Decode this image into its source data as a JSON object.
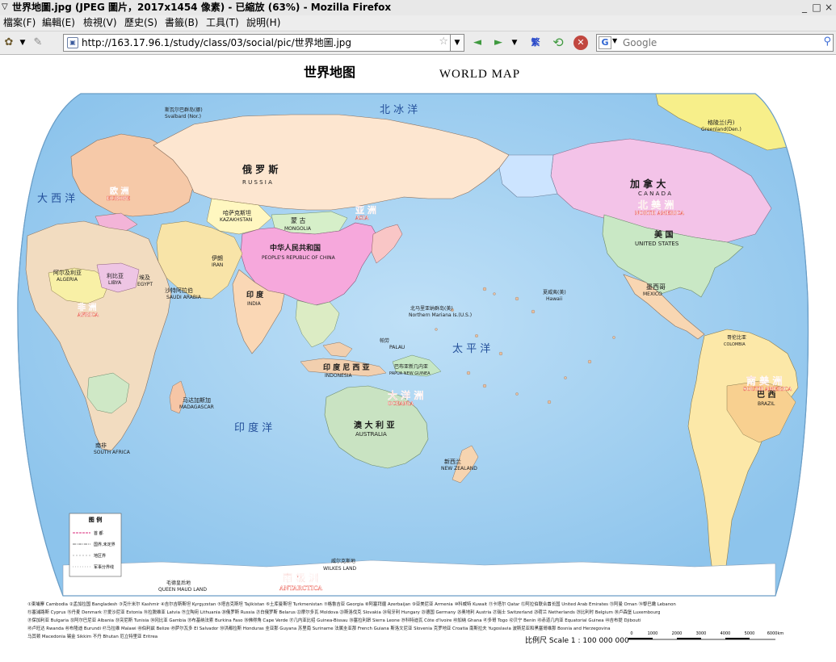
{
  "window": {
    "title": "世界地圖.jpg (JPEG 圖片，2017x1454 像素) - 已縮放 (63%) - Mozilla Firefox",
    "controls": {
      "minimize": "_",
      "maximize": "□",
      "close": "×"
    }
  },
  "menu": {
    "items": [
      "檔案(F)",
      "編輯(E)",
      "檢視(V)",
      "歷史(S)",
      "書籤(B)",
      "工具(T)",
      "說明(H)"
    ]
  },
  "nav": {
    "url": "http://163.17.96.1/study/class/03/social/pic/世界地圖.jpg",
    "search_placeholder": "Google",
    "icons": {
      "back": "◄",
      "forward": "►",
      "reload": "⟲",
      "stop": "✕"
    }
  },
  "map": {
    "title_cn": "世界地图",
    "title_en": "WORLD MAP",
    "colors": {
      "ocean": "#a9d3f2",
      "ocean_deep": "#8cc3ec",
      "background": "#ffffff"
    },
    "oceans": [
      {
        "cn": "北 冰 洋",
        "en": "ARCTIC OCEAN"
      },
      {
        "cn": "太 平 洋",
        "en": "PACIFIC OCEAN"
      },
      {
        "cn": "大 西 洋",
        "en": "ATLANTIC OCEAN"
      },
      {
        "cn": "印 度 洋",
        "en": "INDIAN OCEAN"
      }
    ],
    "countries": [
      {
        "cn": "俄 罗 斯",
        "en": "R U S S I A"
      },
      {
        "cn": "中华人民共和国",
        "en": "PEOPLE'S REPUBLIC OF CHINA"
      },
      {
        "cn": "蒙 古",
        "en": "MONGOLIA"
      },
      {
        "cn": "印 度",
        "en": "INDIA"
      },
      {
        "cn": "印 度 尼 西 亚",
        "en": "INDONESIA"
      },
      {
        "cn": "澳 大 利 亚",
        "en": "AUSTRALIA"
      },
      {
        "cn": "加 拿 大",
        "en": "C A N A D A"
      },
      {
        "cn": "美 国",
        "en": "UNITED STATES"
      },
      {
        "cn": "巴 西",
        "en": "BRAZIL"
      },
      {
        "cn": "墨西哥",
        "en": "MEXICO"
      },
      {
        "cn": "新西兰",
        "en": "NEW ZEALAND"
      },
      {
        "cn": "阿尔及利亚",
        "en": "ALGERIA"
      },
      {
        "cn": "利比亚",
        "en": "LIBYA"
      },
      {
        "cn": "埃及",
        "en": "EGYPT"
      },
      {
        "cn": "哈萨克斯坦",
        "en": "KAZAKHSTAN"
      },
      {
        "cn": "伊朗",
        "en": "IRAN"
      },
      {
        "cn": "沙特阿拉伯",
        "en": "SAUDI ARABIA"
      },
      {
        "cn": "南非",
        "en": "SOUTH AFRICA"
      },
      {
        "cn": "格陵兰(丹)",
        "en": "Greenland(Den.)"
      },
      {
        "cn": "马达加斯加",
        "en": "MADAGASCAR"
      },
      {
        "cn": "巴布亚新几内亚",
        "en": "PAPUA NEW GUINEA"
      },
      {
        "cn": "哥伦比亚",
        "en": "COLOMBIA"
      }
    ],
    "continents": [
      {
        "cn": "北 美 洲",
        "en": "NORTH AMERICA"
      },
      {
        "cn": "南 美 洲",
        "en": "SOUTH AMERICA"
      },
      {
        "cn": "大 洋 洲",
        "en": "OCEANIA"
      },
      {
        "cn": "南 极 洲",
        "en": "ANTARCTICA"
      },
      {
        "cn": "亚 洲",
        "en": "ASIA"
      },
      {
        "cn": "欧 洲",
        "en": "EUROPE"
      },
      {
        "cn": "非 洲",
        "en": "AFRICA"
      }
    ],
    "islands": [
      {
        "cn": "北马里亚纳群岛(美)",
        "en": "Northern Mariana Is.(U.S.)"
      },
      {
        "cn": "威尔克斯地",
        "en": "WILKES LAND"
      },
      {
        "cn": "毛德皇后地",
        "en": "QUEEN MAUD LAND"
      },
      {
        "cn": "斯瓦尔巴群岛(挪)",
        "en": "Svalbard (Nor.)"
      },
      {
        "cn": "夏威夷(美)",
        "en": "Hawaii"
      },
      {
        "cn": "帕劳",
        "en": "PALAU"
      }
    ],
    "legend": {
      "title": "图 例",
      "items": [
        "首 都",
        "国界,未定界",
        "地区界",
        "军事分界线"
      ]
    },
    "footnote_rows": [
      "①柬埔寨 Cambodia ②孟加拉国 Bangladesh ③克什米尔 Kashmir ④吉尔吉斯斯坦 Kyrgyzstan ⑤塔吉克斯坦 Tajikistan ⑥土库曼斯坦 Turkmenistan ⑦格鲁吉亚 Georgia ⑧阿塞拜疆 Azerbaijan ⑨亚美尼亚 Armenia ⑩科威特 Kuwait ⑪卡塔尔 Qatar ⑫阿拉伯联合酋长国 United Arab Emirates ⑬阿曼 Oman ⑭黎巴嫩 Lebanon",
      "⑮塞浦路斯 Cyprus ⑯丹麦 Denmark ⑰爱沙尼亚 Estonia ⑱拉脱维亚 Latvia ⑲立陶宛 Lithuania ⑳俄罗斯 Russia ㉑白俄罗斯 Belarus ㉒摩尔多瓦 Moldova ㉓斯洛伐克 Slovakia ㉔匈牙利 Hungary ㉕德国 Germany ㉖奥地利 Austria ㉗瑞士 Switzerland ㉘荷兰 Netherlands ㉙比利时 Belgium ㉚卢森堡 Luxembourg",
      "㉛保加利亚 Bulgaria ㉜阿尔巴尼亚 Albania ㉝突尼斯 Tunisia ㉞冈比亚 Gambia ㉟布基纳法索 Burkina Faso ㊱佛得角 Cape Verde ㊲几内亚比绍 Guinea-Bissau ㊳塞拉利昂 Sierra Leone ㊴科特迪瓦 Côte d'Ivoire ㊵加纳 Ghana ㊶多哥 Togo ㊷贝宁 Benin ㊸赤道几内亚 Equatorial Guinea ㊹吉布提 Djibouti",
      "㊺卢旺达 Rwanda ㊻布隆迪 Burundi ㊼马拉维 Malawi ㊽伯利兹 Belize ㊾萨尔瓦多 El Salvador ㊿洪都拉斯 Honduras 圭亚那 Guyana 苏里南 Suriname 法属圭亚那 French Guiana 斯洛文尼亚 Slovenia 克罗地亚 Croatia 南斯拉夫 Yugoslavia 波斯尼亚和黑塞哥维那 Bosnia and Herzegovina",
      "马其顿 Macedonia 锡金 Sikkim 不丹 Bhutan 厄立特里亚 Eritrea"
    ],
    "scale": {
      "label": "比例尺 Scale 1 : 100 000 000",
      "ticks": [
        "0",
        "1000",
        "2000",
        "3000",
        "4000",
        "5000",
        "6000km"
      ]
    }
  }
}
